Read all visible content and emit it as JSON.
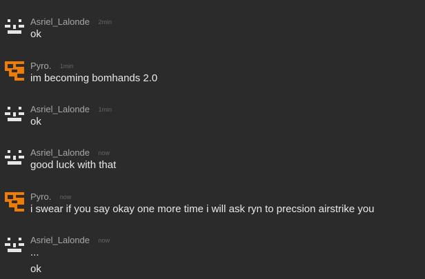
{
  "colors": {
    "background": "#2b2b2b",
    "username": "#a7a7a7",
    "timestamp": "#666666",
    "message": "#e8e8e8",
    "avatar_white": "#e6e6e6",
    "avatar_orange": "#f07d00"
  },
  "messages": [
    {
      "user": "Asriel_Lalonde",
      "avatar_icon": "pixel-face-icon",
      "time": "2min",
      "lines": [
        "ok"
      ]
    },
    {
      "user": "Pyro.",
      "avatar_icon": "orange-glyph-icon",
      "time": "1min",
      "lines": [
        "im becoming bomhands 2.0"
      ]
    },
    {
      "user": "Asriel_Lalonde",
      "avatar_icon": "pixel-face-icon",
      "time": "1min",
      "lines": [
        "ok"
      ]
    },
    {
      "user": "Asriel_Lalonde",
      "avatar_icon": "pixel-face-icon",
      "time": "now",
      "lines": [
        "good luck with that"
      ]
    },
    {
      "user": "Pyro.",
      "avatar_icon": "orange-glyph-icon",
      "time": "now",
      "lines": [
        "i swear if you say okay one more time i will ask ryn to precsion airstrike you"
      ]
    },
    {
      "user": "Asriel_Lalonde",
      "avatar_icon": "pixel-face-icon",
      "time": "now",
      "lines": [
        "...",
        "ok"
      ]
    }
  ]
}
